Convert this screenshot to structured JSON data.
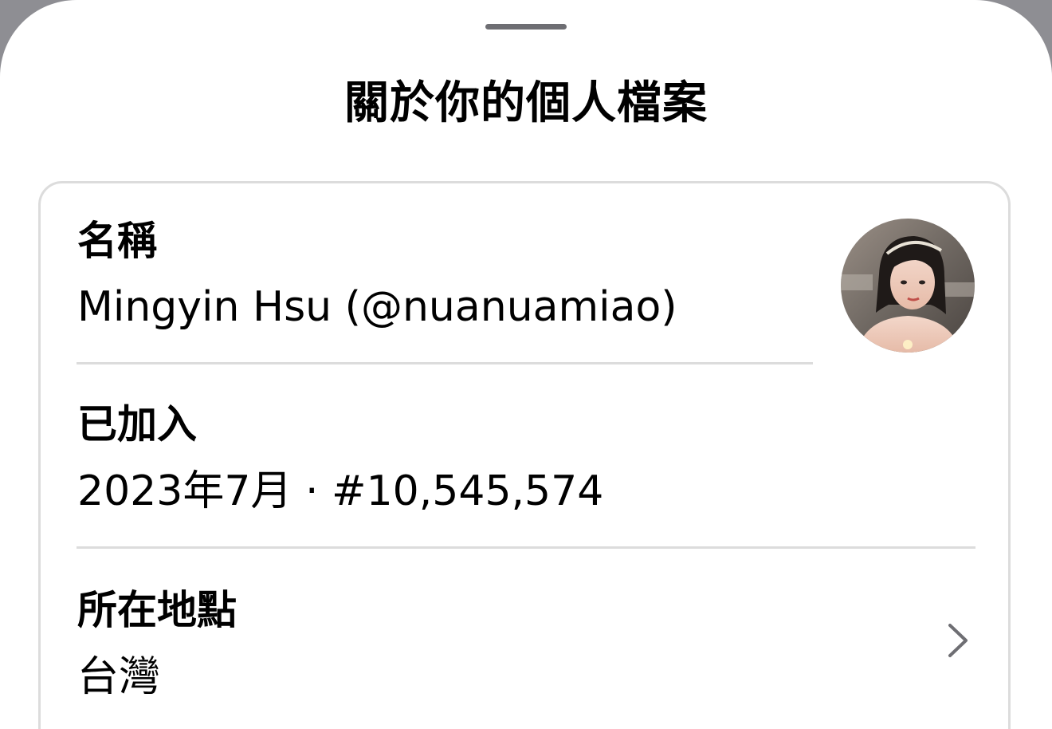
{
  "sheet": {
    "title": "關於你的個人檔案"
  },
  "profile": {
    "name_label": "名稱",
    "name_value": "Mingyin Hsu (@nuanuamiao)",
    "joined_label": "已加入",
    "joined_value": "2023年7月 · #10,545,574",
    "location_label": "所在地點",
    "location_value": "台灣",
    "avatar_icon": "profile-photo",
    "location_chevron_icon": "chevron-right-icon"
  },
  "colors": {
    "background_dim": "#8e8e93",
    "sheet": "#ffffff",
    "divider": "#dcdcdc",
    "grabber": "#6e6e73"
  }
}
